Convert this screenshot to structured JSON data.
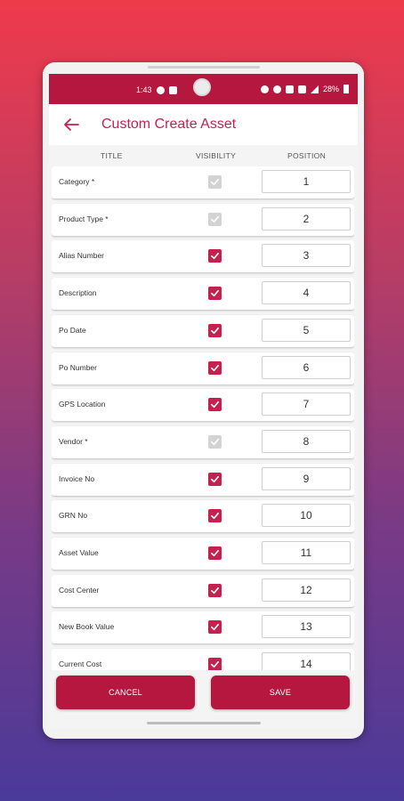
{
  "status_bar": {
    "time": "1:43",
    "battery": "28%"
  },
  "app_bar": {
    "back_icon": "arrow-back-icon",
    "title": "Custom Create Asset"
  },
  "table": {
    "columns": [
      "TITLE",
      "VISIBILITY",
      "POSITION"
    ],
    "rows": [
      {
        "title": "Category *",
        "visible": true,
        "locked": true,
        "position": "1"
      },
      {
        "title": "Product Type *",
        "visible": true,
        "locked": true,
        "position": "2"
      },
      {
        "title": "Alias Number",
        "visible": true,
        "locked": false,
        "position": "3"
      },
      {
        "title": "Description",
        "visible": true,
        "locked": false,
        "position": "4"
      },
      {
        "title": "Po Date",
        "visible": true,
        "locked": false,
        "position": "5"
      },
      {
        "title": "Po Number",
        "visible": true,
        "locked": false,
        "position": "6"
      },
      {
        "title": "GPS Location",
        "visible": true,
        "locked": false,
        "position": "7"
      },
      {
        "title": "Vendor *",
        "visible": true,
        "locked": true,
        "position": "8"
      },
      {
        "title": "Invoice No",
        "visible": true,
        "locked": false,
        "position": "9"
      },
      {
        "title": "GRN No",
        "visible": true,
        "locked": false,
        "position": "10"
      },
      {
        "title": "Asset Value",
        "visible": true,
        "locked": false,
        "position": "11"
      },
      {
        "title": "Cost Center",
        "visible": true,
        "locked": false,
        "position": "12"
      },
      {
        "title": "New Book Value",
        "visible": true,
        "locked": false,
        "position": "13"
      },
      {
        "title": "Current Cost",
        "visible": true,
        "locked": false,
        "position": "14"
      }
    ]
  },
  "footer": {
    "cancel_label": "CANCEL",
    "save_label": "SAVE"
  },
  "colors": {
    "accent": "#b5173f",
    "title_color": "#c4214f",
    "disabled_check": "#d3d3d3"
  }
}
